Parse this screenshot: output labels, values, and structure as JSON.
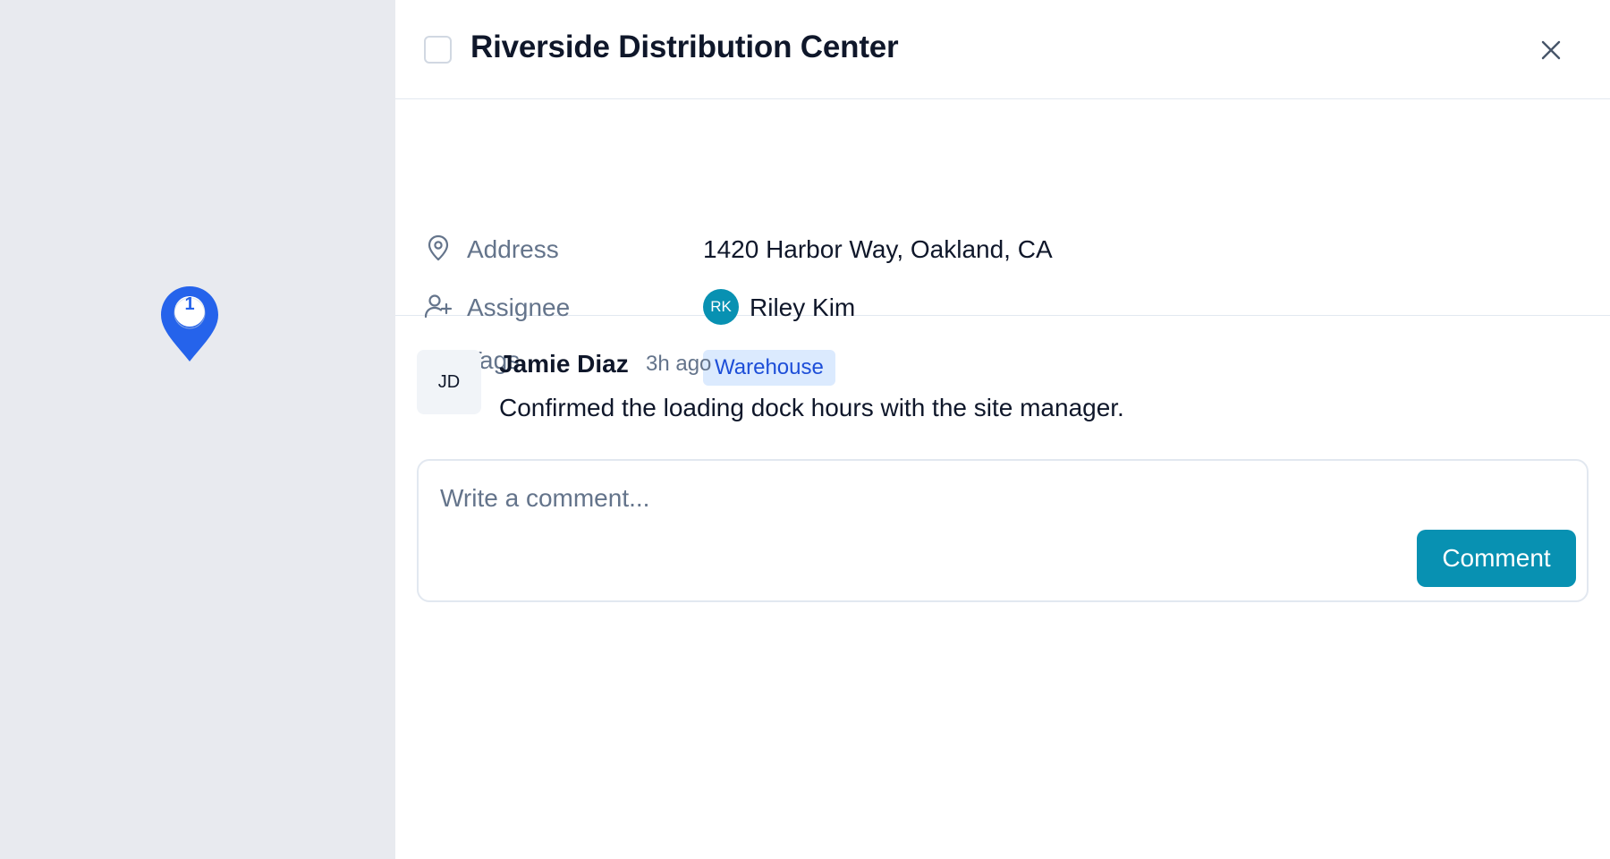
{
  "map": {
    "pin": {
      "count": "1",
      "color": "#2563eb",
      "icon": "map-pin-icon"
    }
  },
  "panel": {
    "title": "Riverside Distribution Center",
    "close_icon": "close-icon",
    "properties": {
      "address": {
        "label": "Address",
        "value": "1420 Harbor Way, Oakland, CA",
        "icon": "location-pin-icon"
      },
      "assignee": {
        "label": "Assignee",
        "initials": "RK",
        "name": "Riley Kim",
        "icon": "user-plus-icon",
        "avatar_color": "#0891b2"
      },
      "tags": {
        "label": "Tags",
        "items": [
          "Warehouse"
        ],
        "icon": "tag-icon"
      }
    },
    "comments": [
      {
        "initials": "JD",
        "author": "Jamie Diaz",
        "time": "3h ago",
        "text": "Confirmed the loading dock hours with the site manager."
      }
    ],
    "composer": {
      "placeholder": "Write a comment...",
      "value": "",
      "submit_label": "Comment",
      "accent": "#0891b2"
    }
  }
}
